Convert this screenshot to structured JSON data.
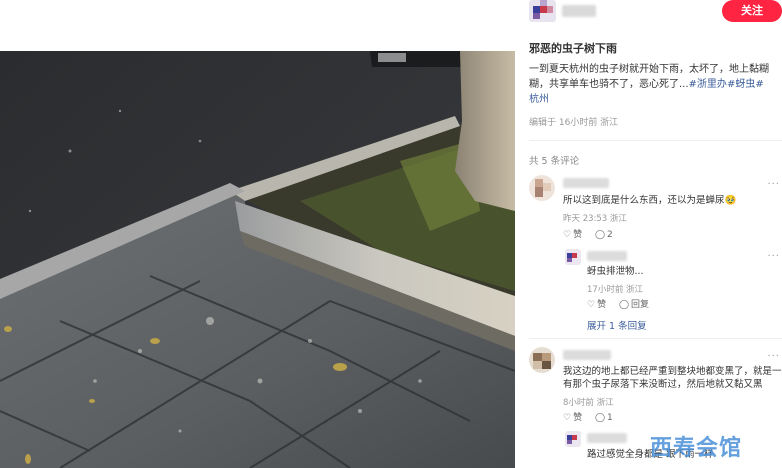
{
  "author": {
    "follow_label": "关注"
  },
  "post": {
    "title": "邪恶的虫子树下雨",
    "body": "一到夏天杭州的虫子树就开始下雨，太坏了，地上黏糊糊，共享单车也骑不了，恶心死了...",
    "tags": [
      "#浙里办",
      "#蚜虫",
      "#杭州"
    ],
    "meta": "编辑于 16小时前 浙江"
  },
  "comments_header": "共 5 条评论",
  "comments": [
    {
      "text": "所以这到底是什么东西，还以为是蝉尿🥹",
      "meta": "昨天 23:53 浙江",
      "like_label": "赞",
      "reply_count": "2",
      "reply": {
        "text": "蚜虫排泄物...",
        "meta": "17小时前 浙江",
        "like_label": "赞",
        "reply_label": "回复"
      },
      "expand_label": "展开 1 条回复"
    },
    {
      "text_line1": "我这边的地上都已经严重到整块地都变黑了，就是一直",
      "text_line2": "有那个虫子尿落下来没断过，然后地就又黏又黑",
      "meta": "8小时前 浙江",
      "like_label": "赞",
      "reply_count": "1",
      "reply": {
        "text": "路过感觉全身都是 跟下雨一样"
      }
    }
  ],
  "watermark": "西寿会馆",
  "colors": {
    "accent": "#ff2442",
    "tag": "#3b5d9a"
  }
}
